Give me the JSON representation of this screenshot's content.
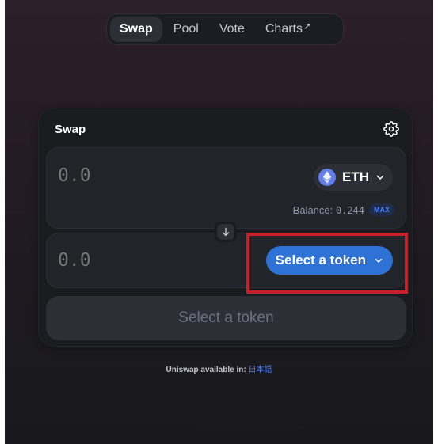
{
  "nav": {
    "items": [
      {
        "label": "Swap",
        "active": true
      },
      {
        "label": "Pool",
        "active": false
      },
      {
        "label": "Vote",
        "active": false
      },
      {
        "label": "Charts",
        "external": "↗"
      }
    ]
  },
  "card": {
    "title": "Swap",
    "settings_icon": "gear-icon"
  },
  "input_panel": {
    "amount_placeholder": "0.0",
    "token_symbol": "ETH",
    "token_icon": "ethereum-icon",
    "balance_label": "Balance:",
    "balance_value": "0.244",
    "max_label": "MAX"
  },
  "switch_icon": "arrow-down-icon",
  "output_panel": {
    "amount_placeholder": "0.0",
    "select_label": "Select a token"
  },
  "submit_label": "Select a token",
  "footer": {
    "text": "Uniswap available in:",
    "link": "日本語"
  },
  "colors": {
    "accent": "#2f72d5",
    "highlight": "#c8202a",
    "card_bg": "#191b1f",
    "panel_bg": "#212429"
  }
}
